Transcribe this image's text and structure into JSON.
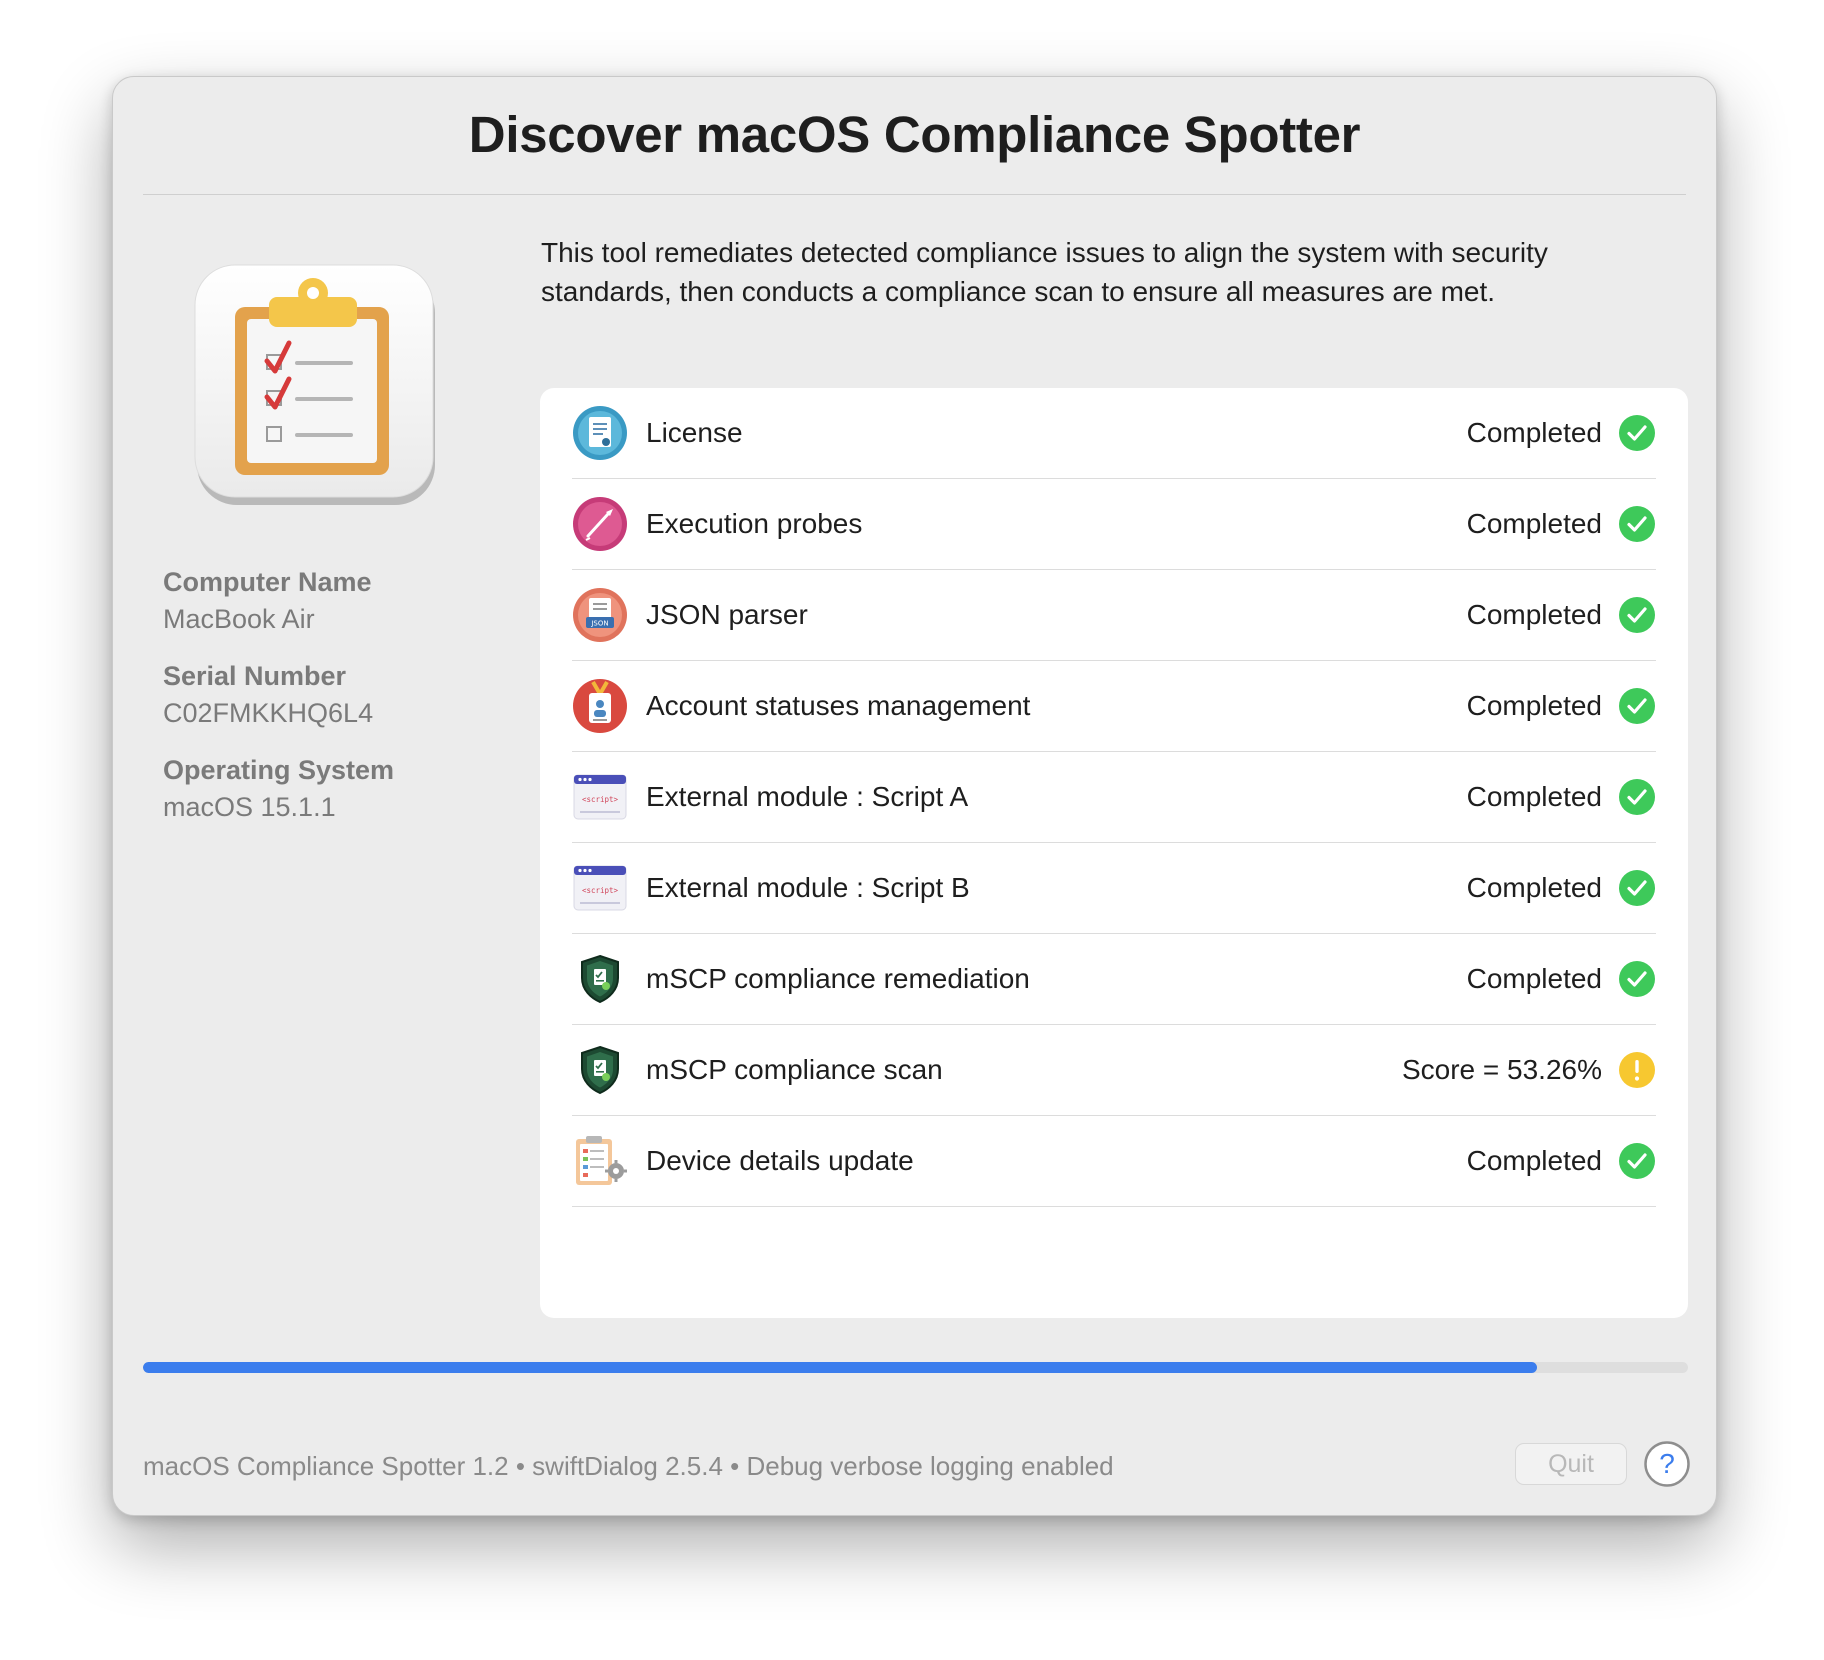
{
  "window": {
    "title": "Discover macOS Compliance Spotter",
    "description": "This tool remediates detected compliance issues to align the system with security standards, then conducts a compliance scan to ensure all measures are met."
  },
  "app_icon": "clipboard-checklist-icon",
  "info": {
    "computer_name_label": "Computer Name",
    "computer_name_value": "MacBook Air",
    "serial_number_label": "Serial Number",
    "serial_number_value": "C02FMKKHQ6L4",
    "os_label": "Operating System",
    "os_value": "macOS 15.1.1"
  },
  "items": [
    {
      "label": "License",
      "status": "Completed",
      "icon": "license-document-icon",
      "state": "success"
    },
    {
      "label": "Execution probes",
      "status": "Completed",
      "icon": "probe-icon",
      "state": "success"
    },
    {
      "label": "JSON parser",
      "status": "Completed",
      "icon": "json-file-icon",
      "state": "success"
    },
    {
      "label": "Account statuses management",
      "status": "Completed",
      "icon": "id-badge-icon",
      "state": "success"
    },
    {
      "label": "External module : Script A",
      "status": "Completed",
      "icon": "script-window-icon",
      "state": "success"
    },
    {
      "label": "External module : Script B",
      "status": "Completed",
      "icon": "script-window-icon",
      "state": "success"
    },
    {
      "label": "mSCP compliance remediation",
      "status": "Completed",
      "icon": "shield-icon",
      "state": "success"
    },
    {
      "label": "mSCP compliance scan",
      "status": "Score = 53.26%",
      "icon": "shield-icon",
      "state": "warning"
    },
    {
      "label": "Device details update",
      "status": "Completed",
      "icon": "clipboard-gear-icon",
      "state": "success"
    }
  ],
  "progress": 0.902,
  "footer": {
    "text": "macOS Compliance Spotter 1.2 • swiftDialog 2.5.4 • Debug verbose logging enabled",
    "quit_label": "Quit",
    "help_icon": "question-mark-icon"
  },
  "colors": {
    "success": "#3ec95a",
    "warning": "#f7c830",
    "accent": "#3b7ded"
  }
}
